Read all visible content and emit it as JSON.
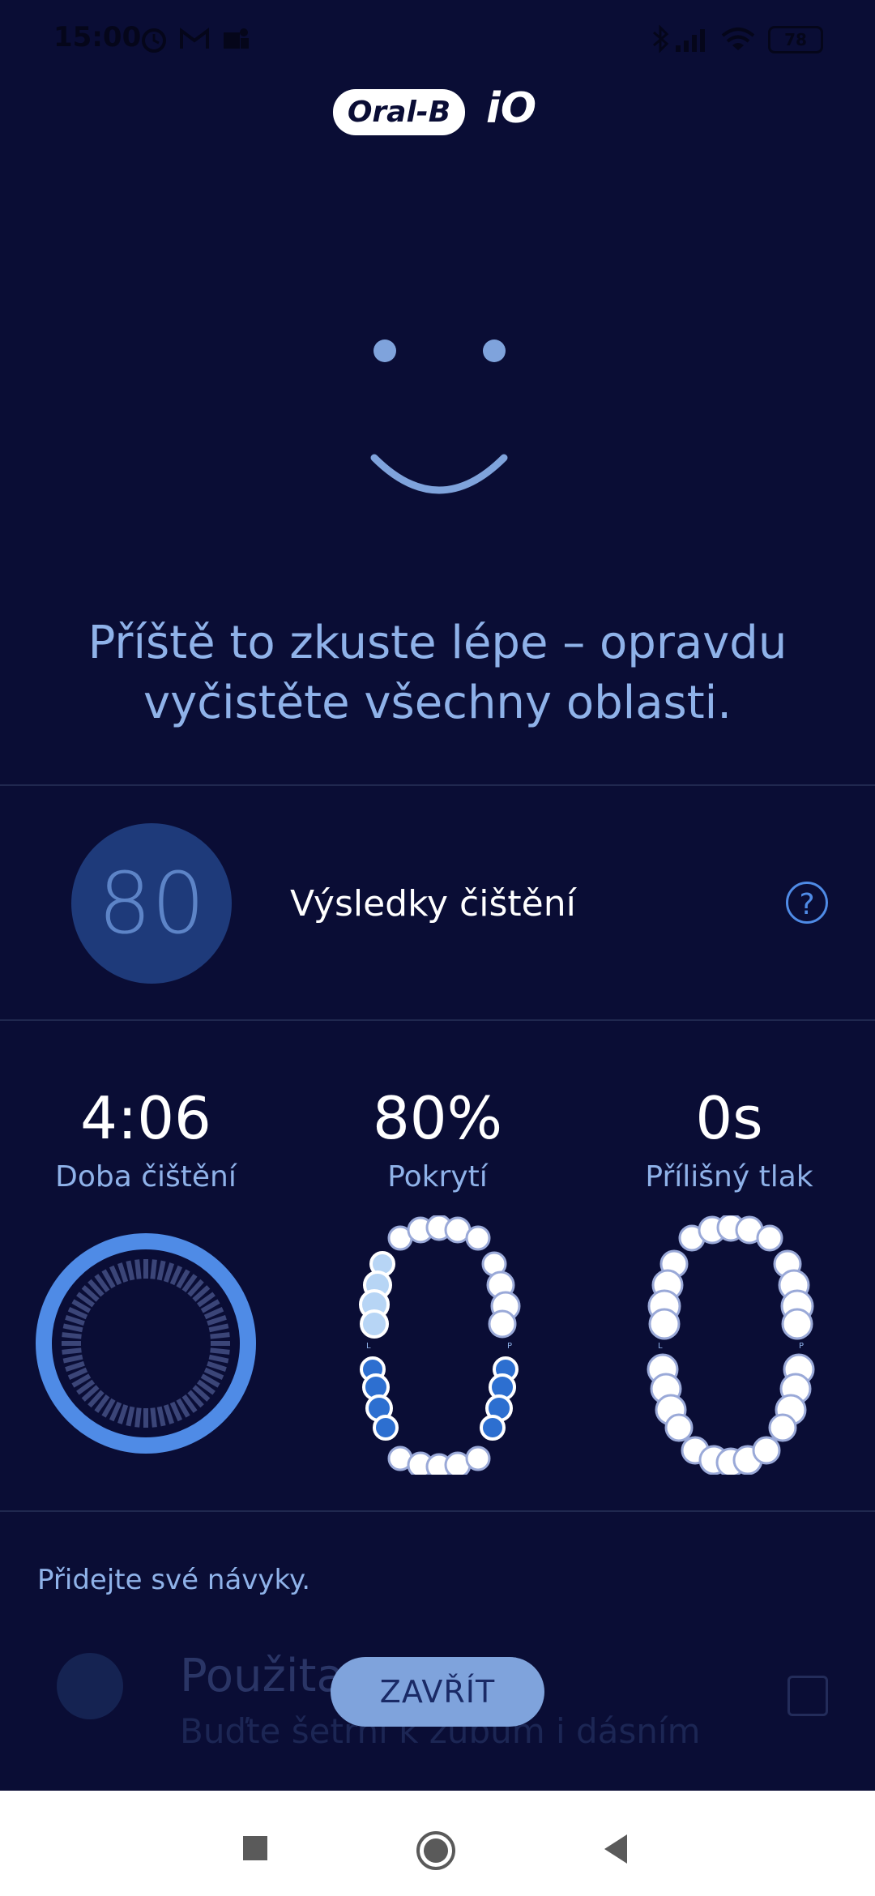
{
  "status_bar": {
    "time": "15:00",
    "left_icons": [
      "alarm-icon",
      "gmail-icon",
      "teams-icon"
    ],
    "right_icons": [
      "bluetooth-icon",
      "signal-icon",
      "wifi-icon",
      "battery-icon"
    ],
    "battery_level": "78"
  },
  "header": {
    "brand": "Oral-B",
    "model": "iO"
  },
  "result": {
    "message": "Příště to zkuste lépe – opravdu vyčistěte všechny oblasti.",
    "score": "80",
    "score_label": "Výsledky čištění",
    "help_icon": "help-circle-icon"
  },
  "stats": [
    {
      "value": "4:06",
      "label": "Doba čištění",
      "graphic": "timer-ring"
    },
    {
      "value": "80%",
      "label": "Pokrytí",
      "graphic": "teeth-coverage-map",
      "left_marker": "L",
      "right_marker": "P"
    },
    {
      "value": "0s",
      "label": "Přílišný tlak",
      "graphic": "teeth-pressure-map",
      "left_marker": "L",
      "right_marker": "P"
    }
  ],
  "habits": {
    "title": "Přidejte své návyky.",
    "item_title": "Použita",
    "item_subtitle": "Buďte šetrní k zubům i dásním"
  },
  "actions": {
    "close_label": "ZAVŘÍT"
  },
  "nav": {
    "icons": [
      "recents-square-icon",
      "home-circle-icon",
      "back-triangle-icon"
    ]
  },
  "colors": {
    "background": "#0a0d35",
    "accent": "#4f8be6",
    "score_circle": "#1e3a7a",
    "close_button": "#7fa3dc"
  }
}
